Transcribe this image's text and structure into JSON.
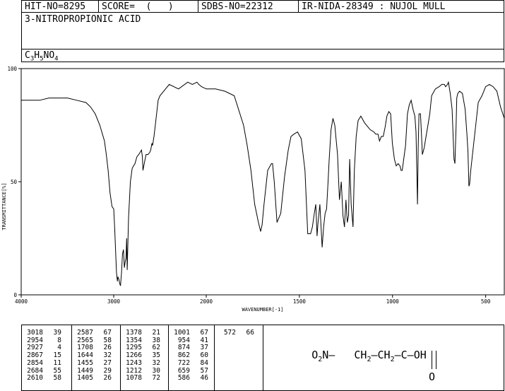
{
  "header": {
    "hit_no": "HIT-NO=8295",
    "score": "SCORE=  (   )",
    "sdbs_no": "SDBS-NO=22312",
    "ir_id": "IR-NIDA-28349 : NUJOL MULL"
  },
  "compound": {
    "name": "3-NITROPROPIONIC ACID",
    "formula_parts": [
      "C",
      "3",
      "H",
      "5",
      "NO",
      "4"
    ]
  },
  "chart_data": {
    "type": "line",
    "xlabel": "WAVENUMBER[-1]",
    "ylabel": "TRANSMITTANCE[%]",
    "xlim": [
      4000,
      400
    ],
    "ylim": [
      0,
      100
    ],
    "xticks": [
      "4000",
      "3000",
      "2000",
      "1500",
      "1000",
      "500"
    ],
    "yticks": [
      "100",
      "50",
      "0"
    ],
    "spectrum_x": [
      4000,
      3900,
      3800,
      3700,
      3600,
      3500,
      3400,
      3300,
      3250,
      3200,
      3150,
      3100,
      3080,
      3060,
      3040,
      3018,
      3000,
      2990,
      2980,
      2970,
      2960,
      2954,
      2945,
      2935,
      2927,
      2915,
      2905,
      2895,
      2885,
      2875,
      2867,
      2860,
      2854,
      2840,
      2820,
      2800,
      2770,
      2750,
      2730,
      2700,
      2690,
      2684,
      2670,
      2650,
      2630,
      2610,
      2600,
      2587,
      2580,
      2565,
      2550,
      2520,
      2500,
      2400,
      2300,
      2200,
      2150,
      2100,
      2080,
      2050,
      2000,
      1950,
      1900,
      1850,
      1800,
      1780,
      1760,
      1740,
      1720,
      1708,
      1700,
      1690,
      1670,
      1650,
      1644,
      1635,
      1620,
      1600,
      1580,
      1560,
      1545,
      1530,
      1510,
      1490,
      1470,
      1455,
      1440,
      1430,
      1420,
      1412,
      1405,
      1400,
      1390,
      1378,
      1370,
      1362,
      1354,
      1346,
      1340,
      1330,
      1320,
      1310,
      1295,
      1285,
      1275,
      1266,
      1258,
      1250,
      1243,
      1236,
      1230,
      1222,
      1212,
      1205,
      1195,
      1185,
      1170,
      1150,
      1120,
      1100,
      1090,
      1078,
      1070,
      1060,
      1050,
      1040,
      1030,
      1020,
      1010,
      1001,
      990,
      980,
      970,
      960,
      954,
      948,
      940,
      930,
      920,
      910,
      900,
      890,
      880,
      874,
      870,
      866,
      862,
      858,
      850,
      845,
      840,
      830,
      820,
      810,
      800,
      790,
      770,
      750,
      735,
      722,
      715,
      705,
      700,
      690,
      680,
      670,
      665,
      659,
      655,
      650,
      640,
      625,
      610,
      600,
      595,
      590,
      586,
      580,
      560,
      540,
      520,
      500,
      480,
      460,
      440,
      420,
      400
    ],
    "spectrum_y": [
      86,
      86,
      86,
      87,
      87,
      87,
      86,
      85,
      83,
      80,
      75,
      68,
      62,
      55,
      45,
      39,
      38,
      30,
      20,
      10,
      6,
      8,
      7,
      5,
      4,
      10,
      18,
      20,
      12,
      15,
      16,
      25,
      11,
      34,
      50,
      56,
      58,
      61,
      62,
      64,
      61,
      55,
      58,
      62,
      62,
      63,
      64,
      67,
      66,
      70,
      75,
      86,
      88,
      93,
      91,
      94,
      93,
      94,
      93,
      92,
      91,
      91,
      90,
      88,
      75,
      66,
      55,
      40,
      32,
      28,
      31,
      40,
      55,
      58,
      58,
      50,
      32,
      36,
      52,
      64,
      70,
      71,
      72,
      69,
      55,
      27,
      27,
      30,
      36,
      40,
      26,
      32,
      40,
      21,
      30,
      36,
      38,
      50,
      60,
      73,
      78,
      75,
      62,
      42,
      50,
      35,
      30,
      42,
      32,
      35,
      60,
      40,
      30,
      55,
      70,
      77,
      79,
      76,
      73,
      72,
      71,
      71,
      68,
      70,
      70,
      74,
      79,
      81,
      80,
      67,
      60,
      57,
      58,
      57,
      55,
      55,
      60,
      66,
      80,
      84,
      86,
      82,
      79,
      72,
      57,
      40,
      65,
      80,
      80,
      72,
      62,
      65,
      70,
      75,
      80,
      88,
      91,
      92,
      93,
      93,
      92,
      93,
      94,
      89,
      82,
      60,
      58,
      74,
      87,
      89,
      90,
      89,
      82,
      70,
      63,
      48,
      49,
      55,
      70,
      85,
      88,
      92,
      93,
      92,
      90,
      83,
      78,
      76,
      82,
      79
    ]
  },
  "peaks": {
    "columns": [
      [
        [
          "3018",
          "39"
        ],
        [
          "2954",
          "8"
        ],
        [
          "2927",
          "4"
        ],
        [
          "2867",
          "15"
        ],
        [
          "2854",
          "11"
        ],
        [
          "2684",
          "55"
        ],
        [
          "2610",
          "58"
        ]
      ],
      [
        [
          "2587",
          "67"
        ],
        [
          "2565",
          "58"
        ],
        [
          "1708",
          "26"
        ],
        [
          "1644",
          "32"
        ],
        [
          "1455",
          "27"
        ],
        [
          "1449",
          "29"
        ],
        [
          "1405",
          "26"
        ]
      ],
      [
        [
          "1378",
          "21"
        ],
        [
          "1354",
          "38"
        ],
        [
          "1295",
          "62"
        ],
        [
          "1266",
          "35"
        ],
        [
          "1243",
          "32"
        ],
        [
          "1212",
          "30"
        ],
        [
          "1078",
          "72"
        ]
      ],
      [
        [
          "1001",
          "67"
        ],
        [
          "954",
          "41"
        ],
        [
          "874",
          "37"
        ],
        [
          "862",
          "60"
        ],
        [
          "722",
          "84"
        ],
        [
          "659",
          "57"
        ],
        [
          "586",
          "46"
        ]
      ],
      [
        [
          "572",
          "66"
        ]
      ]
    ]
  },
  "structure": {
    "line1_parts": [
      "O",
      "2",
      "N—",
      "CH",
      "2",
      "—CH",
      "2",
      "—C—OH"
    ],
    "o_label": "O"
  }
}
